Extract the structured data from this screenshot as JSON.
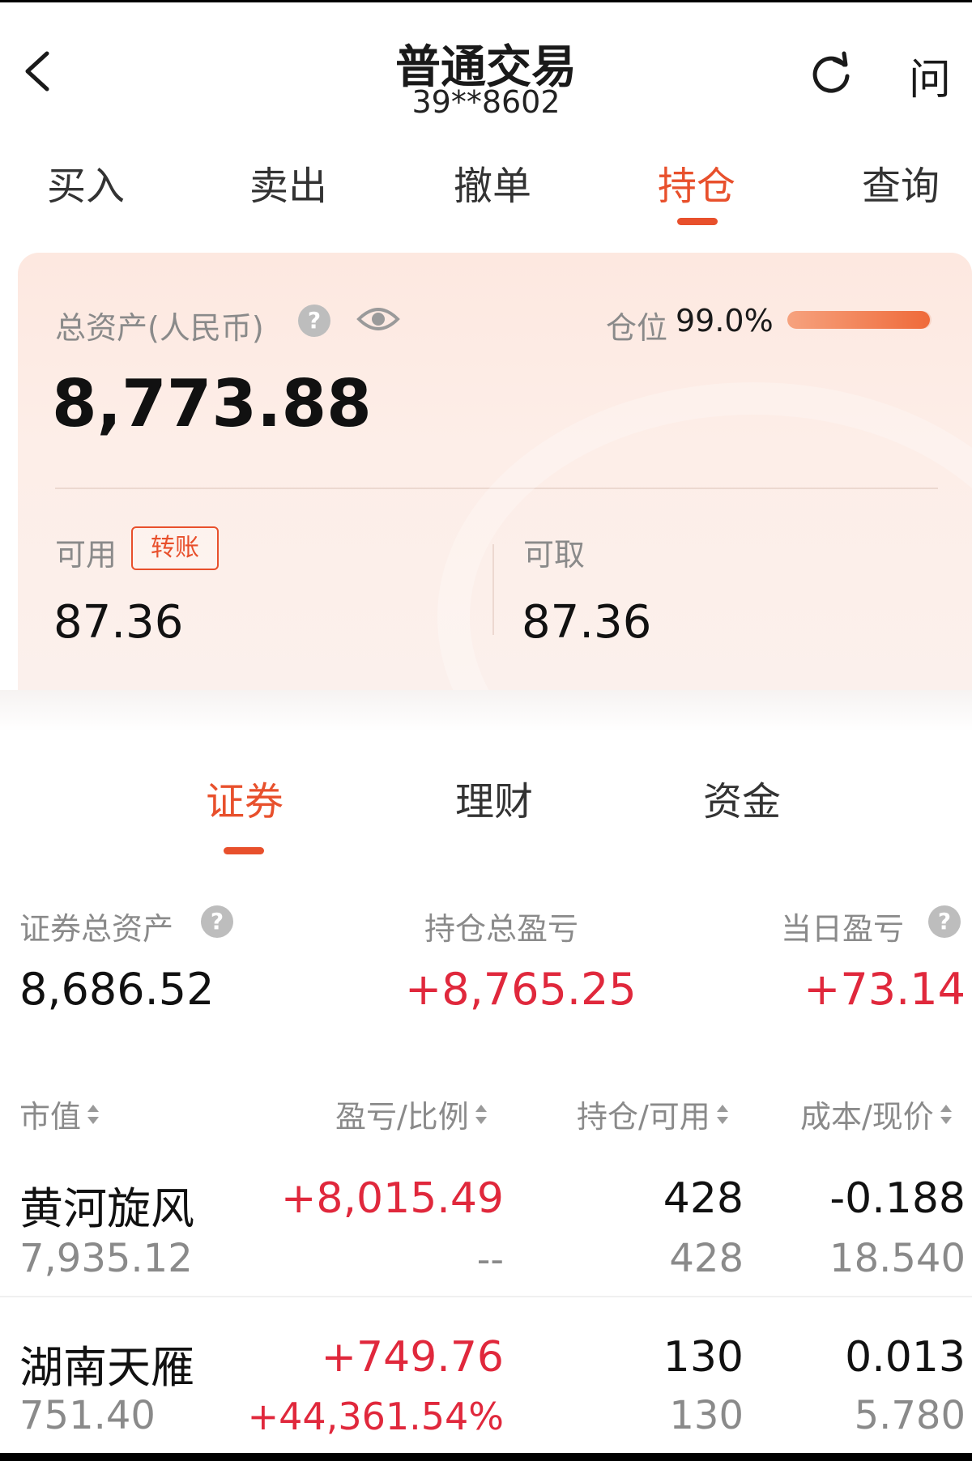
{
  "header": {
    "title": "普通交易",
    "account": "39**8602",
    "help_label": "问"
  },
  "top_tabs": [
    {
      "label": "买入"
    },
    {
      "label": "卖出"
    },
    {
      "label": "撤单"
    },
    {
      "label": "持仓",
      "active": true
    },
    {
      "label": "查询"
    }
  ],
  "asset_card": {
    "total_label": "总资产(人民币)",
    "total_value": "8,773.88",
    "help_icon": "?",
    "position_label": "仓位",
    "position_value": "99.0%",
    "position_ratio": 0.99,
    "available_label": "可用",
    "transfer_label": "转账",
    "available_value": "87.36",
    "withdrawable_label": "可取",
    "withdrawable_value": "87.36"
  },
  "sub_tabs": [
    {
      "label": "证券",
      "active": true
    },
    {
      "label": "理财"
    },
    {
      "label": "资金"
    }
  ],
  "summary": {
    "securities_total_label": "证券总资产",
    "securities_total_value": "8,686.52",
    "holding_pl_label": "持仓总盈亏",
    "holding_pl_value": "+8,765.25",
    "daily_pl_label": "当日盈亏",
    "daily_pl_value": "+73.14"
  },
  "table": {
    "columns": [
      "市值",
      "盈亏/比例",
      "持仓/可用",
      "成本/现价"
    ],
    "rows": [
      {
        "name": "黄河旋风",
        "market_value": "7,935.12",
        "pl": "+8,015.49",
        "pl_ratio": "--",
        "holding": "428",
        "available": "428",
        "cost": "-0.188",
        "price": "18.540"
      },
      {
        "name": "湖南天雁",
        "market_value": "751.40",
        "pl": "+749.76",
        "pl_ratio": "+44,361.54%",
        "holding": "130",
        "available": "130",
        "cost": "0.013",
        "price": "5.780"
      }
    ]
  },
  "colors": {
    "accent": "#e8502c",
    "profit": "#e0283c"
  }
}
